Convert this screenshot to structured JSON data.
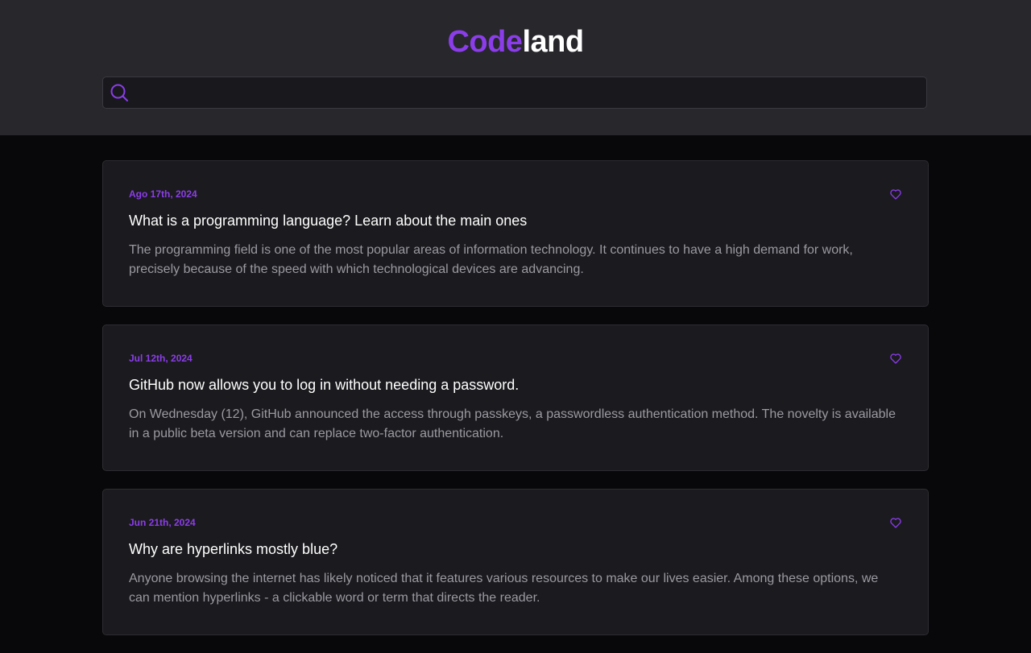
{
  "brand": {
    "part1": "Code",
    "part2": "land",
    "accent_color": "#8b3dea"
  },
  "search": {
    "placeholder": "",
    "value": "",
    "icon": "search-icon"
  },
  "posts": [
    {
      "date": "Ago 17th, 2024",
      "title": "What is a programming language? Learn about the main ones",
      "excerpt": "The programming field is one of the most popular areas of information technology. It continues to have a high demand for work, precisely because of the speed with which technological devices are advancing.",
      "icon": "heart-icon"
    },
    {
      "date": "Jul 12th, 2024",
      "title": "GitHub now allows you to log in without needing a password.",
      "excerpt": "On Wednesday (12), GitHub announced the access through passkeys, a passwordless authentication method. The novelty is available in a public beta version and can replace two-factor authentication.",
      "icon": "heart-icon"
    },
    {
      "date": "Jun 21th, 2024",
      "title": "Why are hyperlinks mostly blue?",
      "excerpt": "Anyone browsing the internet has likely noticed that it features various resources to make our lives easier. Among these options, we can mention hyperlinks - a clickable word or term that directs the reader.",
      "icon": "heart-icon"
    }
  ]
}
